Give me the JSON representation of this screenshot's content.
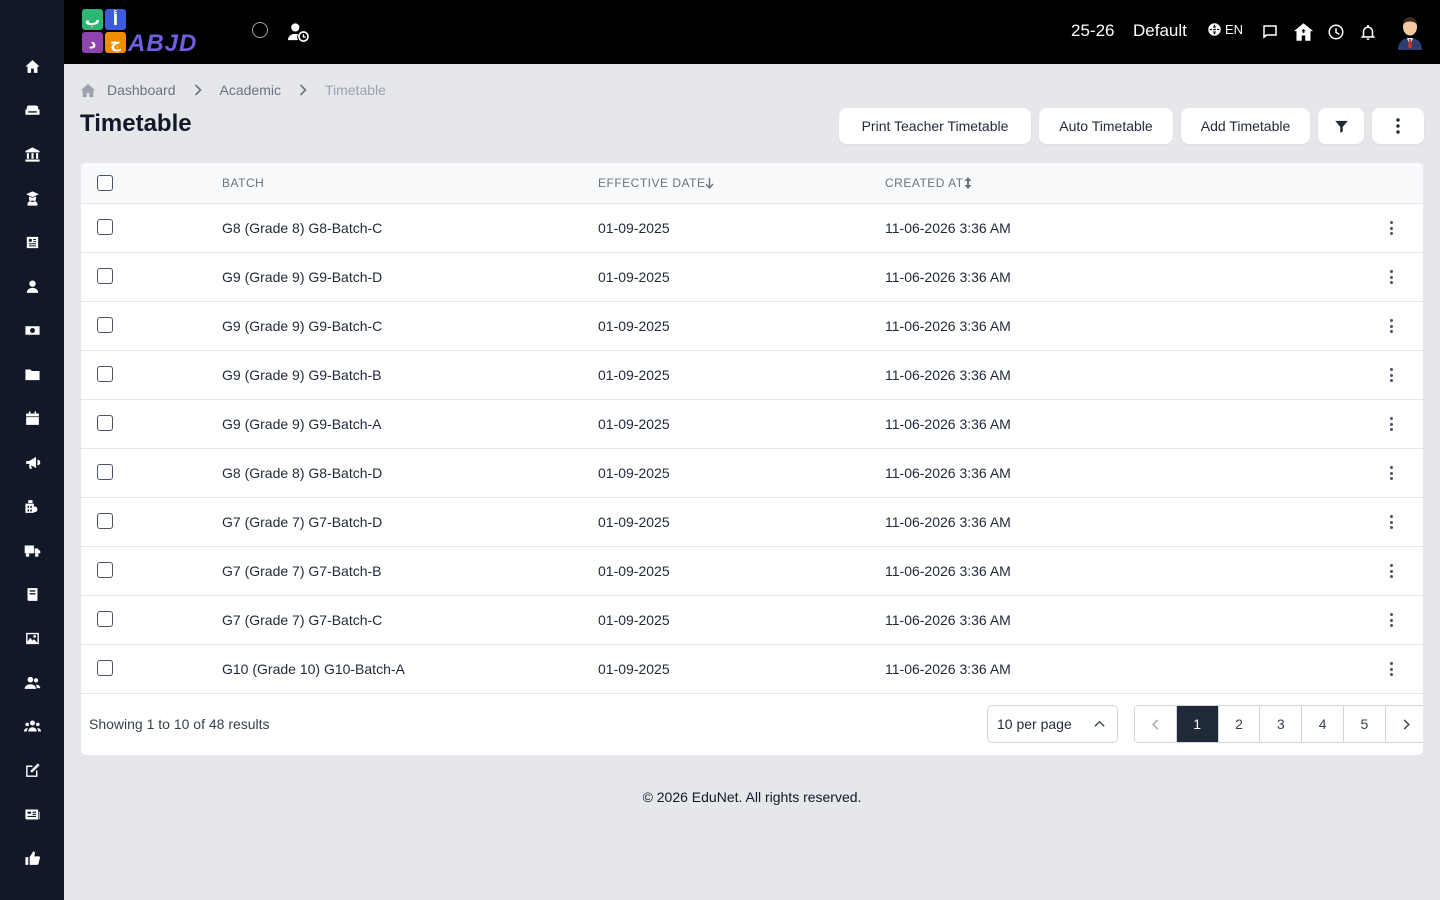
{
  "brand": {
    "logo_text": "ABJD",
    "logo_glyphs": [
      "ب",
      "أ",
      "د",
      "ج"
    ],
    "logo_tile_colors": [
      "#2bb673",
      "#3b5bdb",
      "#8e44ad",
      "#f08c00"
    ]
  },
  "sidebar": {
    "items": [
      {
        "icon": "home-icon"
      },
      {
        "icon": "sofa-icon"
      },
      {
        "icon": "institution-icon"
      },
      {
        "icon": "teacher-icon"
      },
      {
        "icon": "newspaper-icon"
      },
      {
        "icon": "user-icon"
      },
      {
        "icon": "money-icon"
      },
      {
        "icon": "folder-icon"
      },
      {
        "icon": "calendar-icon"
      },
      {
        "icon": "megaphone-icon"
      },
      {
        "icon": "campus-icon"
      },
      {
        "icon": "truck-icon"
      },
      {
        "icon": "book-icon"
      },
      {
        "icon": "image-icon"
      },
      {
        "icon": "users-icon"
      },
      {
        "icon": "group-icon"
      },
      {
        "icon": "edit-icon"
      },
      {
        "icon": "news-icon"
      },
      {
        "icon": "thumbs-up-icon"
      }
    ]
  },
  "topbar": {
    "session": "25-26",
    "team": "Default",
    "language": "EN"
  },
  "breadcrumb": {
    "items": [
      "Dashboard",
      "Academic",
      "Timetable"
    ]
  },
  "page": {
    "title": "Timetable",
    "buttons": {
      "print_teacher": "Print Teacher Timetable",
      "auto": "Auto Timetable",
      "add": "Add Timetable"
    }
  },
  "table": {
    "columns": {
      "batch": "BATCH",
      "effective_date": "EFFECTIVE DATE",
      "created_at": "CREATED AT"
    },
    "rows": [
      {
        "batch": "G8 (Grade 8) G8-Batch-C",
        "effective_date": "01-09-2025",
        "created_at": "11-06-2026 3:36 AM"
      },
      {
        "batch": "G9 (Grade 9) G9-Batch-D",
        "effective_date": "01-09-2025",
        "created_at": "11-06-2026 3:36 AM"
      },
      {
        "batch": "G9 (Grade 9) G9-Batch-C",
        "effective_date": "01-09-2025",
        "created_at": "11-06-2026 3:36 AM"
      },
      {
        "batch": "G9 (Grade 9) G9-Batch-B",
        "effective_date": "01-09-2025",
        "created_at": "11-06-2026 3:36 AM"
      },
      {
        "batch": "G9 (Grade 9) G9-Batch-A",
        "effective_date": "01-09-2025",
        "created_at": "11-06-2026 3:36 AM"
      },
      {
        "batch": "G8 (Grade 8) G8-Batch-D",
        "effective_date": "01-09-2025",
        "created_at": "11-06-2026 3:36 AM"
      },
      {
        "batch": "G7 (Grade 7) G7-Batch-D",
        "effective_date": "01-09-2025",
        "created_at": "11-06-2026 3:36 AM"
      },
      {
        "batch": "G7 (Grade 7) G7-Batch-B",
        "effective_date": "01-09-2025",
        "created_at": "11-06-2026 3:36 AM"
      },
      {
        "batch": "G7 (Grade 7) G7-Batch-C",
        "effective_date": "01-09-2025",
        "created_at": "11-06-2026 3:36 AM"
      },
      {
        "batch": "G10 (Grade 10) G10-Batch-A",
        "effective_date": "01-09-2025",
        "created_at": "11-06-2026 3:36 AM"
      }
    ]
  },
  "pagination": {
    "summary": "Showing 1 to 10 of 48 results",
    "per_page": "10 per page",
    "pages": [
      "1",
      "2",
      "3",
      "4",
      "5"
    ],
    "current": "1"
  },
  "footer": {
    "copyright": "© 2026 EduNet. All rights reserved."
  }
}
